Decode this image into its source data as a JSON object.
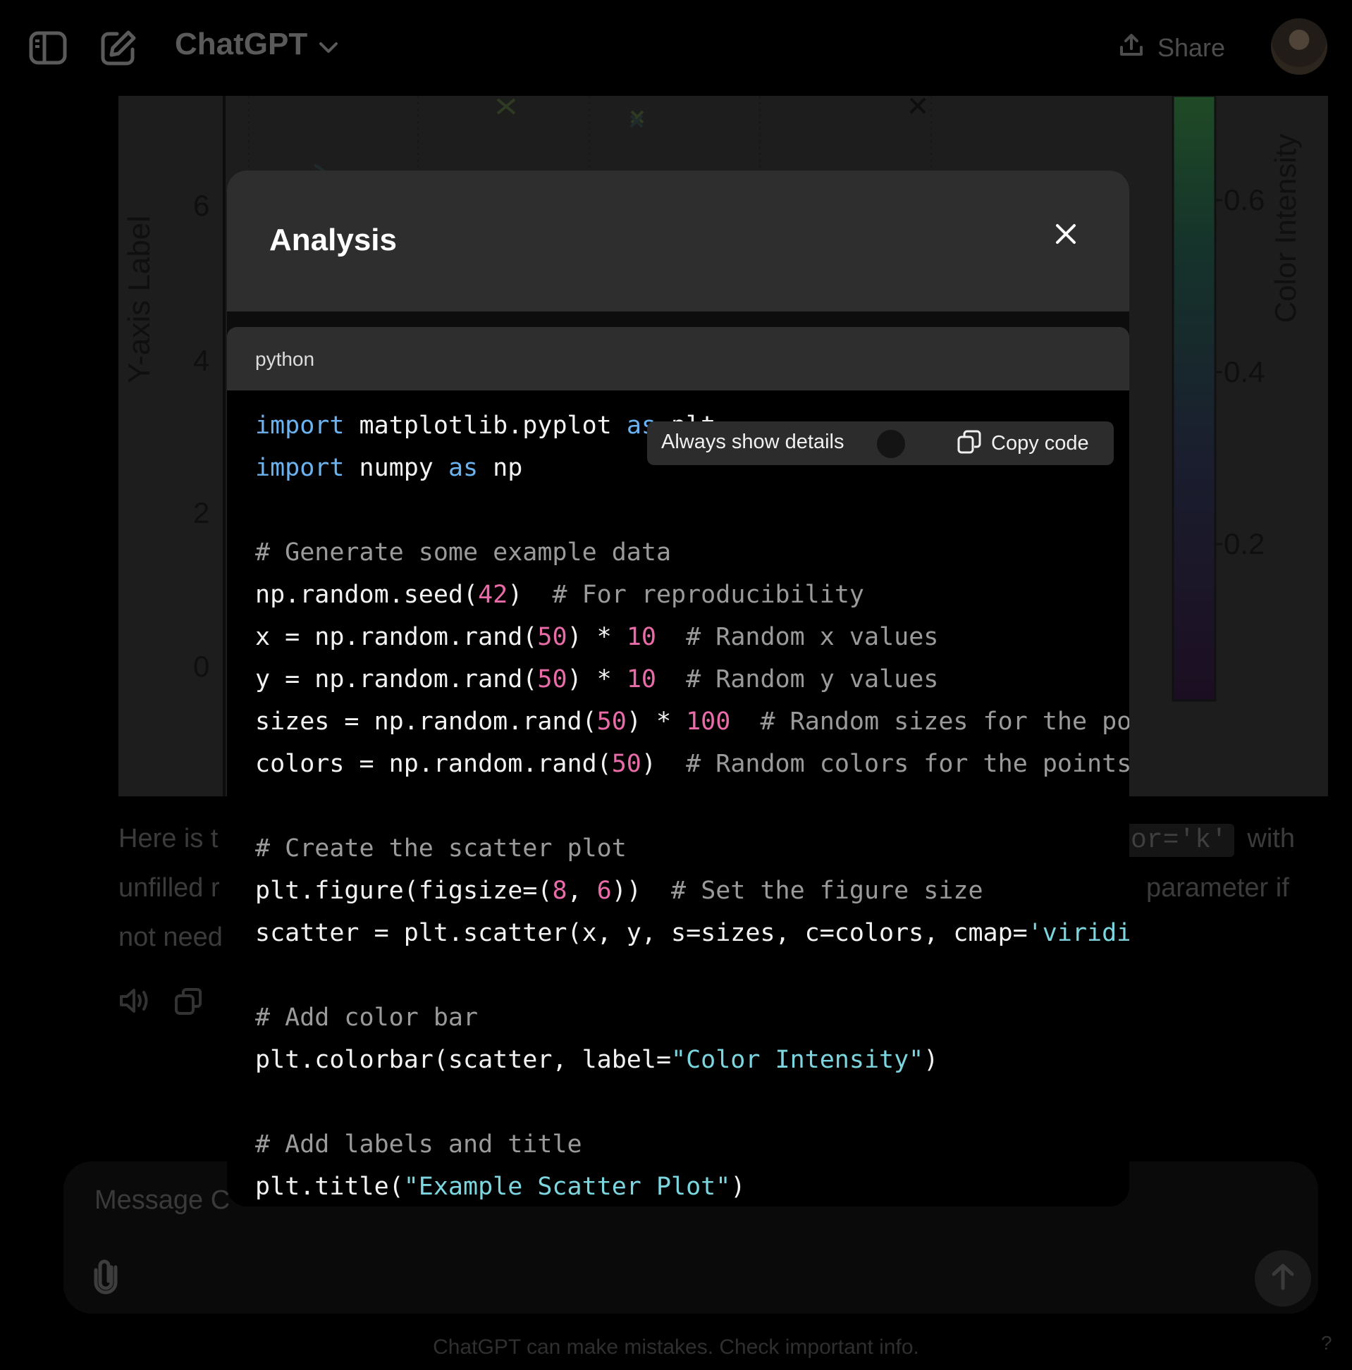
{
  "header": {
    "app_title": "ChatGPT",
    "share_label": "Share",
    "icons": [
      "sidebar-toggle-icon",
      "new-chat-icon",
      "chevron-down-icon",
      "upload-icon"
    ]
  },
  "background_plot": {
    "ylabel": "Y-axis Label",
    "y_ticks": [
      "6",
      "4",
      "2",
      "0"
    ],
    "colorbar_label": "Color Intensity",
    "colorbar_ticks": [
      "0.6",
      "0.4",
      "0.2"
    ],
    "colormap": "viridis"
  },
  "assistant_message": {
    "line1_start": "Here is t",
    "line1_chip": "or='k'",
    "line1_end": "with",
    "line2_start": "unfilled r",
    "line2_end": "parameter if",
    "line3_start": "not need"
  },
  "composer": {
    "placeholder": "Message C",
    "footer": "ChatGPT can make mistakes. Check important info.",
    "help": "?"
  },
  "modal": {
    "title": "Analysis",
    "language": "python",
    "always_show_details_label": "Always show details",
    "copy_label": "Copy code",
    "code_lines": [
      [
        {
          "t": "import",
          "c": "kw"
        },
        {
          "t": " matplotlib.pyplot "
        },
        {
          "t": "as",
          "c": "kw"
        },
        {
          "t": " plt"
        }
      ],
      [
        {
          "t": "import",
          "c": "kw"
        },
        {
          "t": " numpy "
        },
        {
          "t": "as",
          "c": "kw"
        },
        {
          "t": " np"
        }
      ],
      [],
      [
        {
          "t": "# Generate some example data",
          "c": "cm"
        }
      ],
      [
        {
          "t": "np.random.seed("
        },
        {
          "t": "42",
          "c": "num"
        },
        {
          "t": ")  "
        },
        {
          "t": "# For reproducibility",
          "c": "cm"
        }
      ],
      [
        {
          "t": "x = np.random.rand("
        },
        {
          "t": "50",
          "c": "num"
        },
        {
          "t": ") * "
        },
        {
          "t": "10",
          "c": "num"
        },
        {
          "t": "  "
        },
        {
          "t": "# Random x values",
          "c": "cm"
        }
      ],
      [
        {
          "t": "y = np.random.rand("
        },
        {
          "t": "50",
          "c": "num"
        },
        {
          "t": ") * "
        },
        {
          "t": "10",
          "c": "num"
        },
        {
          "t": "  "
        },
        {
          "t": "# Random y values",
          "c": "cm"
        }
      ],
      [
        {
          "t": "sizes = np.random.rand("
        },
        {
          "t": "50",
          "c": "num"
        },
        {
          "t": ") * "
        },
        {
          "t": "100",
          "c": "num"
        },
        {
          "t": "  "
        },
        {
          "t": "# Random sizes for the points",
          "c": "cm"
        }
      ],
      [
        {
          "t": "colors = np.random.rand("
        },
        {
          "t": "50",
          "c": "num"
        },
        {
          "t": ")  "
        },
        {
          "t": "# Random colors for the points",
          "c": "cm"
        }
      ],
      [],
      [
        {
          "t": "# Create the scatter plot",
          "c": "cm"
        }
      ],
      [
        {
          "t": "plt.figure(figsize=("
        },
        {
          "t": "8",
          "c": "num"
        },
        {
          "t": ", "
        },
        {
          "t": "6",
          "c": "num"
        },
        {
          "t": "))  "
        },
        {
          "t": "# Set the figure size",
          "c": "cm"
        }
      ],
      [
        {
          "t": "scatter = plt.scatter(x, y, s=sizes, c=colors, cmap="
        },
        {
          "t": "'viridis'",
          "c": "str"
        }
      ],
      [],
      [
        {
          "t": "# Add color bar",
          "c": "cm"
        }
      ],
      [
        {
          "t": "plt.colorbar(scatter, label="
        },
        {
          "t": "\"Color Intensity\"",
          "c": "str"
        },
        {
          "t": ")"
        }
      ],
      [],
      [
        {
          "t": "# Add labels and title",
          "c": "cm"
        }
      ],
      [
        {
          "t": "plt.title("
        },
        {
          "t": "\"Example Scatter Plot\"",
          "c": "str"
        },
        {
          "t": ")"
        }
      ]
    ]
  }
}
